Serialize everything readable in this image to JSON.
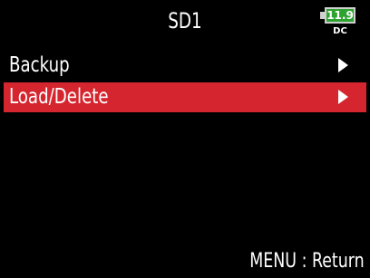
{
  "header": {
    "title": "SD1",
    "battery": {
      "voltage": "11.9",
      "source": "DC",
      "color": "#2fa332"
    }
  },
  "menu": {
    "items": [
      {
        "label": "Backup",
        "selected": false,
        "icon": "chevron-right-icon"
      },
      {
        "label": "Load/Delete",
        "selected": true,
        "icon": "chevron-right-icon"
      }
    ],
    "highlight_color": "#d5262f"
  },
  "footer": {
    "hint": "MENU : Return"
  }
}
